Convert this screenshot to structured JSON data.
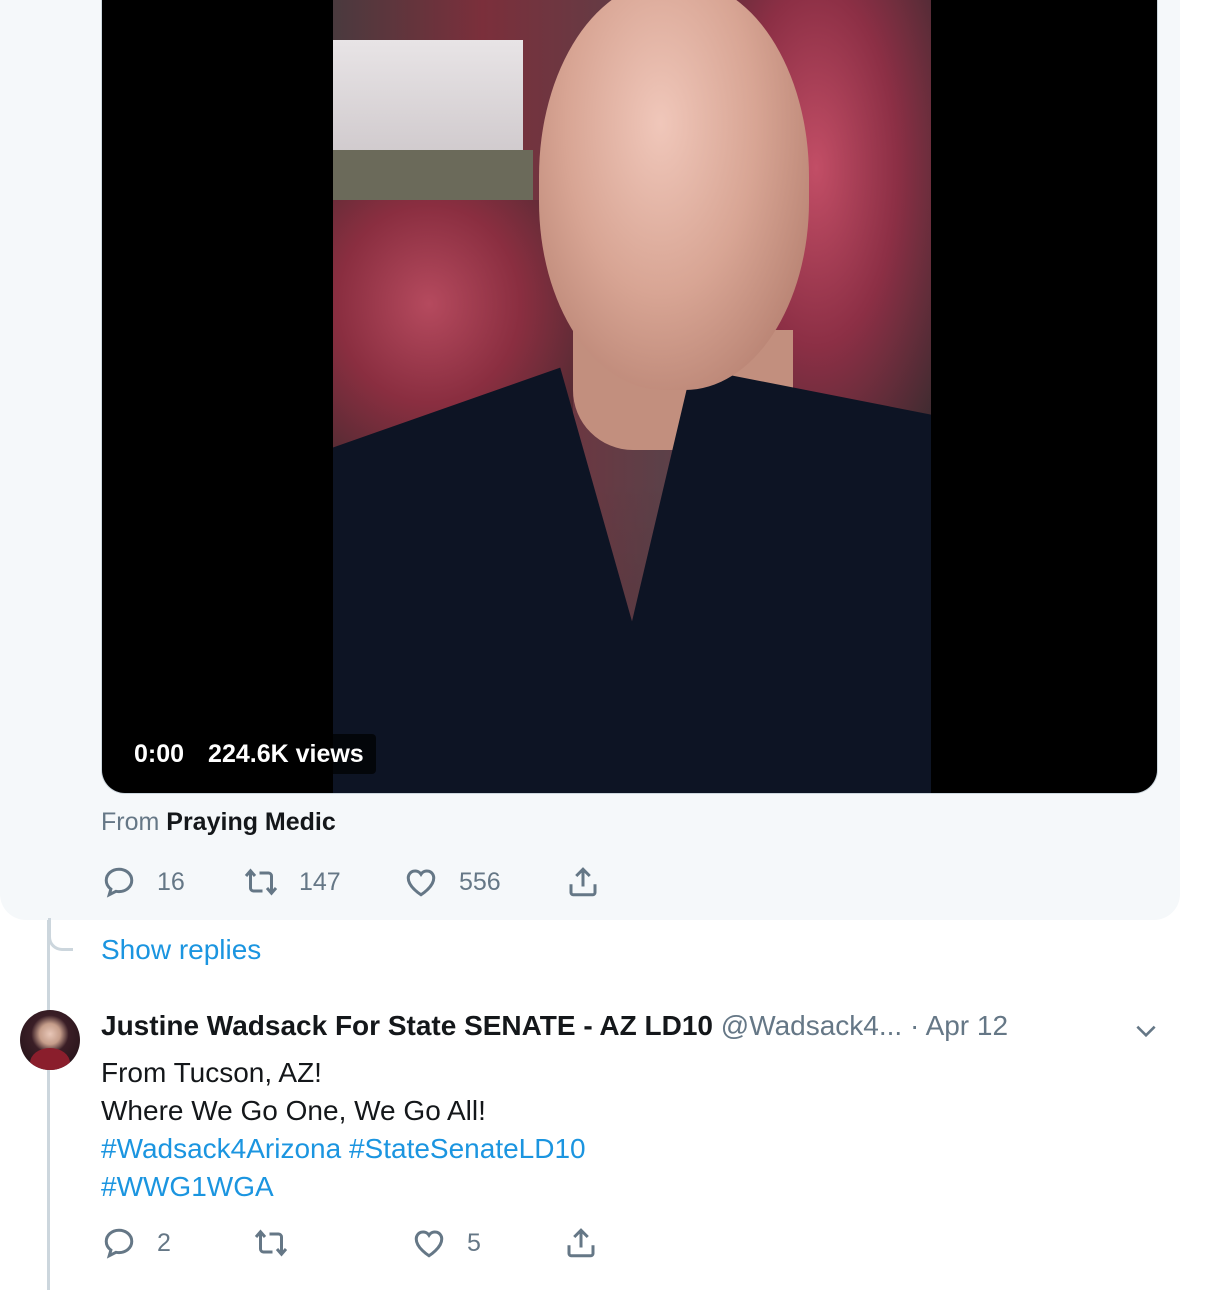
{
  "quoted_tweet": {
    "video": {
      "time": "0:00",
      "views": "224.6K views"
    },
    "from_prefix": "From",
    "from_name": "Praying Medic",
    "actions": {
      "replies": "16",
      "retweets": "147",
      "likes": "556"
    }
  },
  "show_replies": "Show replies",
  "tweet": {
    "name": "Justine Wadsack For State SENATE - AZ LD10",
    "handle": "@Wadsack4...",
    "separator": "·",
    "date": "Apr 12",
    "lines": [
      "From Tucson, AZ!",
      "Where We Go One, We Go All!"
    ],
    "hashtags": [
      "#Wadsack4Arizona",
      "#StateSenateLD10",
      "#WWG1WGA"
    ],
    "actions": {
      "replies": "2",
      "retweets": "",
      "likes": "5"
    }
  },
  "icons": {
    "reply": "reply-icon",
    "retweet": "retweet-icon",
    "like": "heart-icon",
    "share": "share-icon",
    "caret": "chevron-down-icon"
  },
  "colors": {
    "link": "#1b95e0",
    "secondary_text": "#657786",
    "primary_text": "#14171a",
    "card_background": "#f5f8fa",
    "thread_line": "#ccd6dd"
  }
}
